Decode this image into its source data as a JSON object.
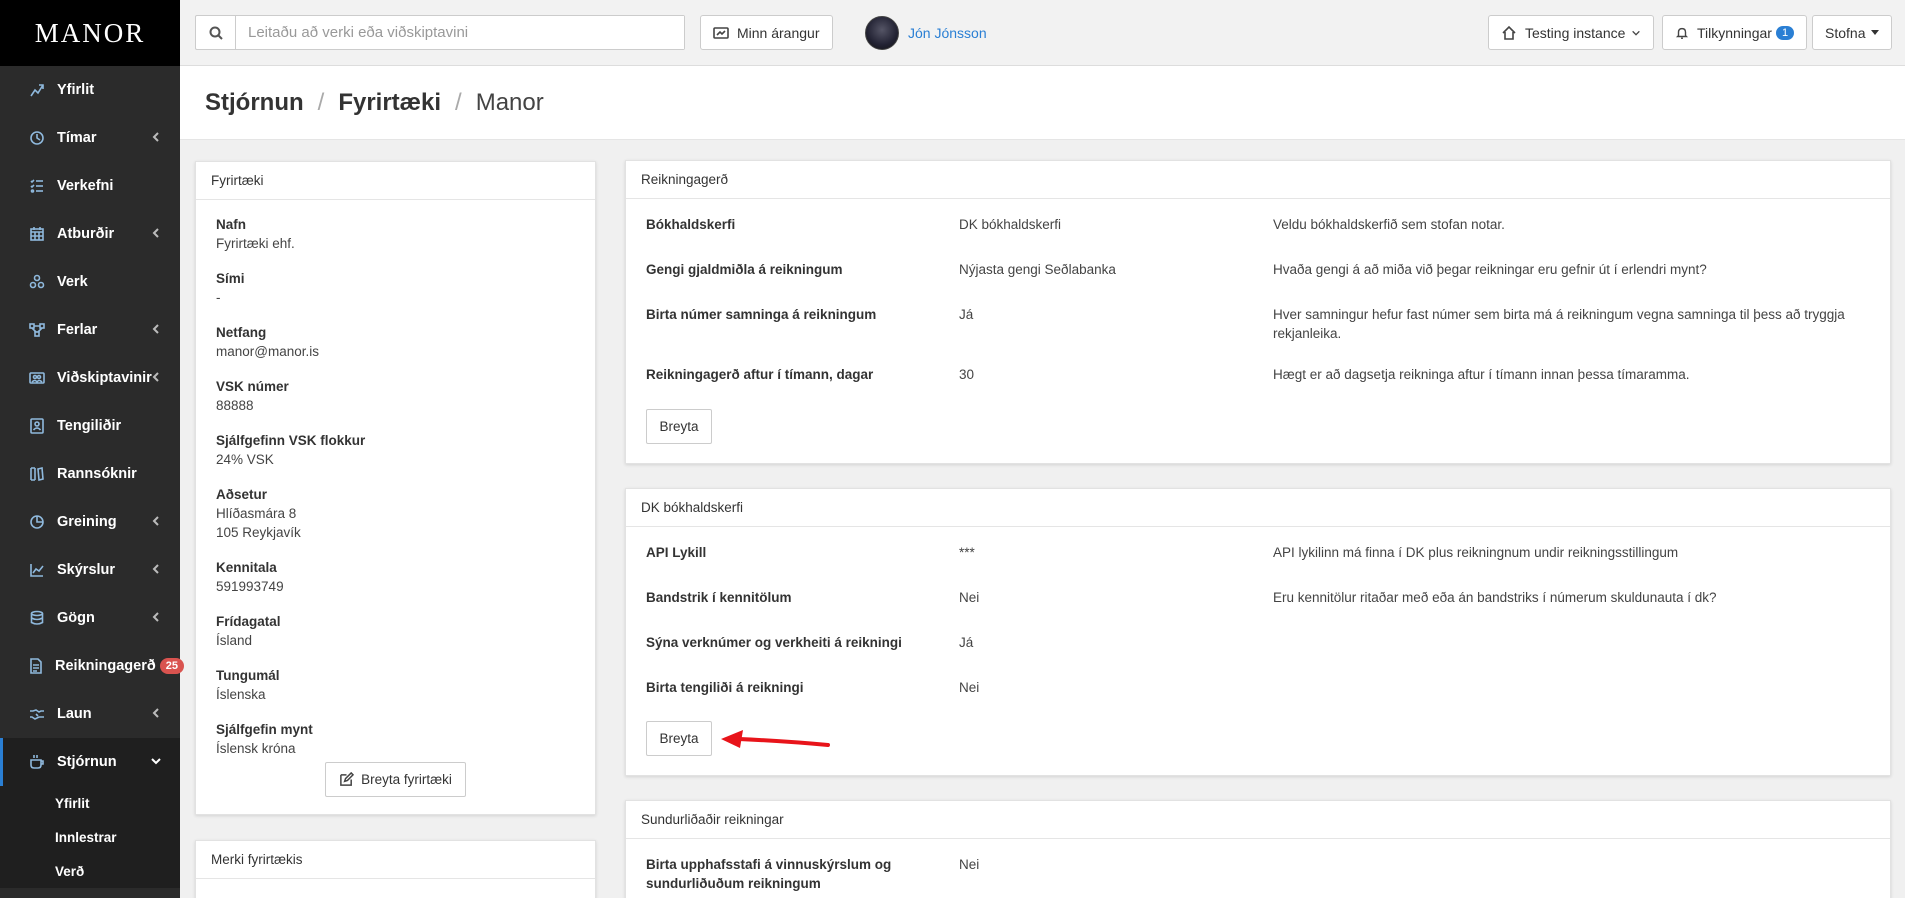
{
  "app": {
    "logo": "MANOR"
  },
  "sidebar": {
    "items": [
      {
        "label": "Yfirlit",
        "icon": "chart-icon"
      },
      {
        "label": "Tímar",
        "icon": "clock-icon"
      },
      {
        "label": "Verkefni",
        "icon": "tasks-icon"
      },
      {
        "label": "Atburðir",
        "icon": "calendar-icon"
      },
      {
        "label": "Verk",
        "icon": "projects-icon"
      },
      {
        "label": "Ferlar",
        "icon": "flow-icon"
      },
      {
        "label": "Viðskiptavinir",
        "icon": "customers-icon"
      },
      {
        "label": "Tengiliðir",
        "icon": "contact-icon"
      },
      {
        "label": "Rannsóknir",
        "icon": "research-icon"
      },
      {
        "label": "Greining",
        "icon": "pie-icon"
      },
      {
        "label": "Skýrslur",
        "icon": "report-icon"
      },
      {
        "label": "Gögn",
        "icon": "database-icon"
      },
      {
        "label": "Reikningagerð",
        "icon": "invoice-icon",
        "badge": "25"
      },
      {
        "label": "Laun",
        "icon": "handshake-icon"
      },
      {
        "label": "Stjórnun",
        "icon": "coffee-icon"
      }
    ],
    "subitems": [
      "Yfirlit",
      "Innlestrar",
      "Verð"
    ]
  },
  "topbar": {
    "search_placeholder": "Leitaðu að verki eða viðskiptavini",
    "achievements": "Minn árangur",
    "user_name": "Jón Jónsson",
    "instance": "Testing instance",
    "notifications": "Tilkynningar",
    "notifications_count": "1",
    "create": "Stofna"
  },
  "breadcrumb": {
    "level1": "Stjórnun",
    "level2": "Fyrirtæki",
    "level3": "Manor",
    "sep": "/"
  },
  "company": {
    "title": "Fyrirtæki",
    "fields": [
      {
        "label": "Nafn",
        "value": "Fyrirtæki ehf."
      },
      {
        "label": "Sími",
        "value": "-"
      },
      {
        "label": "Netfang",
        "value": "manor@manor.is"
      },
      {
        "label": "VSK númer",
        "value": "88888"
      },
      {
        "label": "Sjálfgefinn VSK flokkur",
        "value": "24% VSK"
      },
      {
        "label": "Aðsetur",
        "value": "Hlíðasmára 8",
        "value2": "105 Reykjavík"
      },
      {
        "label": "Kennitala",
        "value": "591993749"
      },
      {
        "label": "Frídagatal",
        "value": "Ísland"
      },
      {
        "label": "Tungumál",
        "value": "Íslenska"
      },
      {
        "label": "Sjálfgefin mynt",
        "value": "Íslensk króna"
      }
    ],
    "edit_button": "Breyta fyrirtæki",
    "logo_panel_title": "Merki fyrirtækis"
  },
  "invoicing": {
    "title": "Reikningagerð",
    "rows": [
      {
        "label": "Bókhaldskerfi",
        "value": "DK bókhaldskerfi",
        "desc": "Veldu bókhaldskerfið sem stofan notar."
      },
      {
        "label": "Gengi gjaldmiðla á reikningum",
        "value": "Nýjasta gengi Seðlabanka",
        "desc": "Hvaða gengi á að miða við þegar reikningar eru gefnir út í erlendri mynt?"
      },
      {
        "label": "Birta númer samninga á reikningum",
        "value": "Já",
        "desc": "Hver samningur hefur fast númer sem birta má á reikningum vegna samninga til þess að tryggja rekjanleika."
      },
      {
        "label": "Reikningagerð aftur í tímann, dagar",
        "value": "30",
        "desc": "Hægt er að dagsetja reikninga aftur í tímann innan þessa tímaramma."
      }
    ],
    "edit_button": "Breyta"
  },
  "dk": {
    "title": "DK bókhaldskerfi",
    "rows": [
      {
        "label": "API Lykill",
        "value": "***",
        "desc": "API lykilinn má finna í DK plus reikningnum undir reikningsstillingum"
      },
      {
        "label": "Bandstrik í kennitölum",
        "value": "Nei",
        "desc": "Eru kennitölur ritaðar með eða án bandstriks í númerum skuldunauta í dk?"
      },
      {
        "label": "Sýna verknúmer og verkheiti á reikningi",
        "value": "Já",
        "desc": ""
      },
      {
        "label": "Birta tengiliði á reikningi",
        "value": "Nei",
        "desc": ""
      }
    ],
    "edit_button": "Breyta",
    "arrow_color": "#e8141a"
  },
  "itemized": {
    "title": "Sundurliðaðir reikningar",
    "rows": [
      {
        "label": "Birta upphafsstafi á vinnuskýrslum og",
        "label2": "sundurliðuðum reikningum",
        "value": "Nei"
      }
    ]
  }
}
